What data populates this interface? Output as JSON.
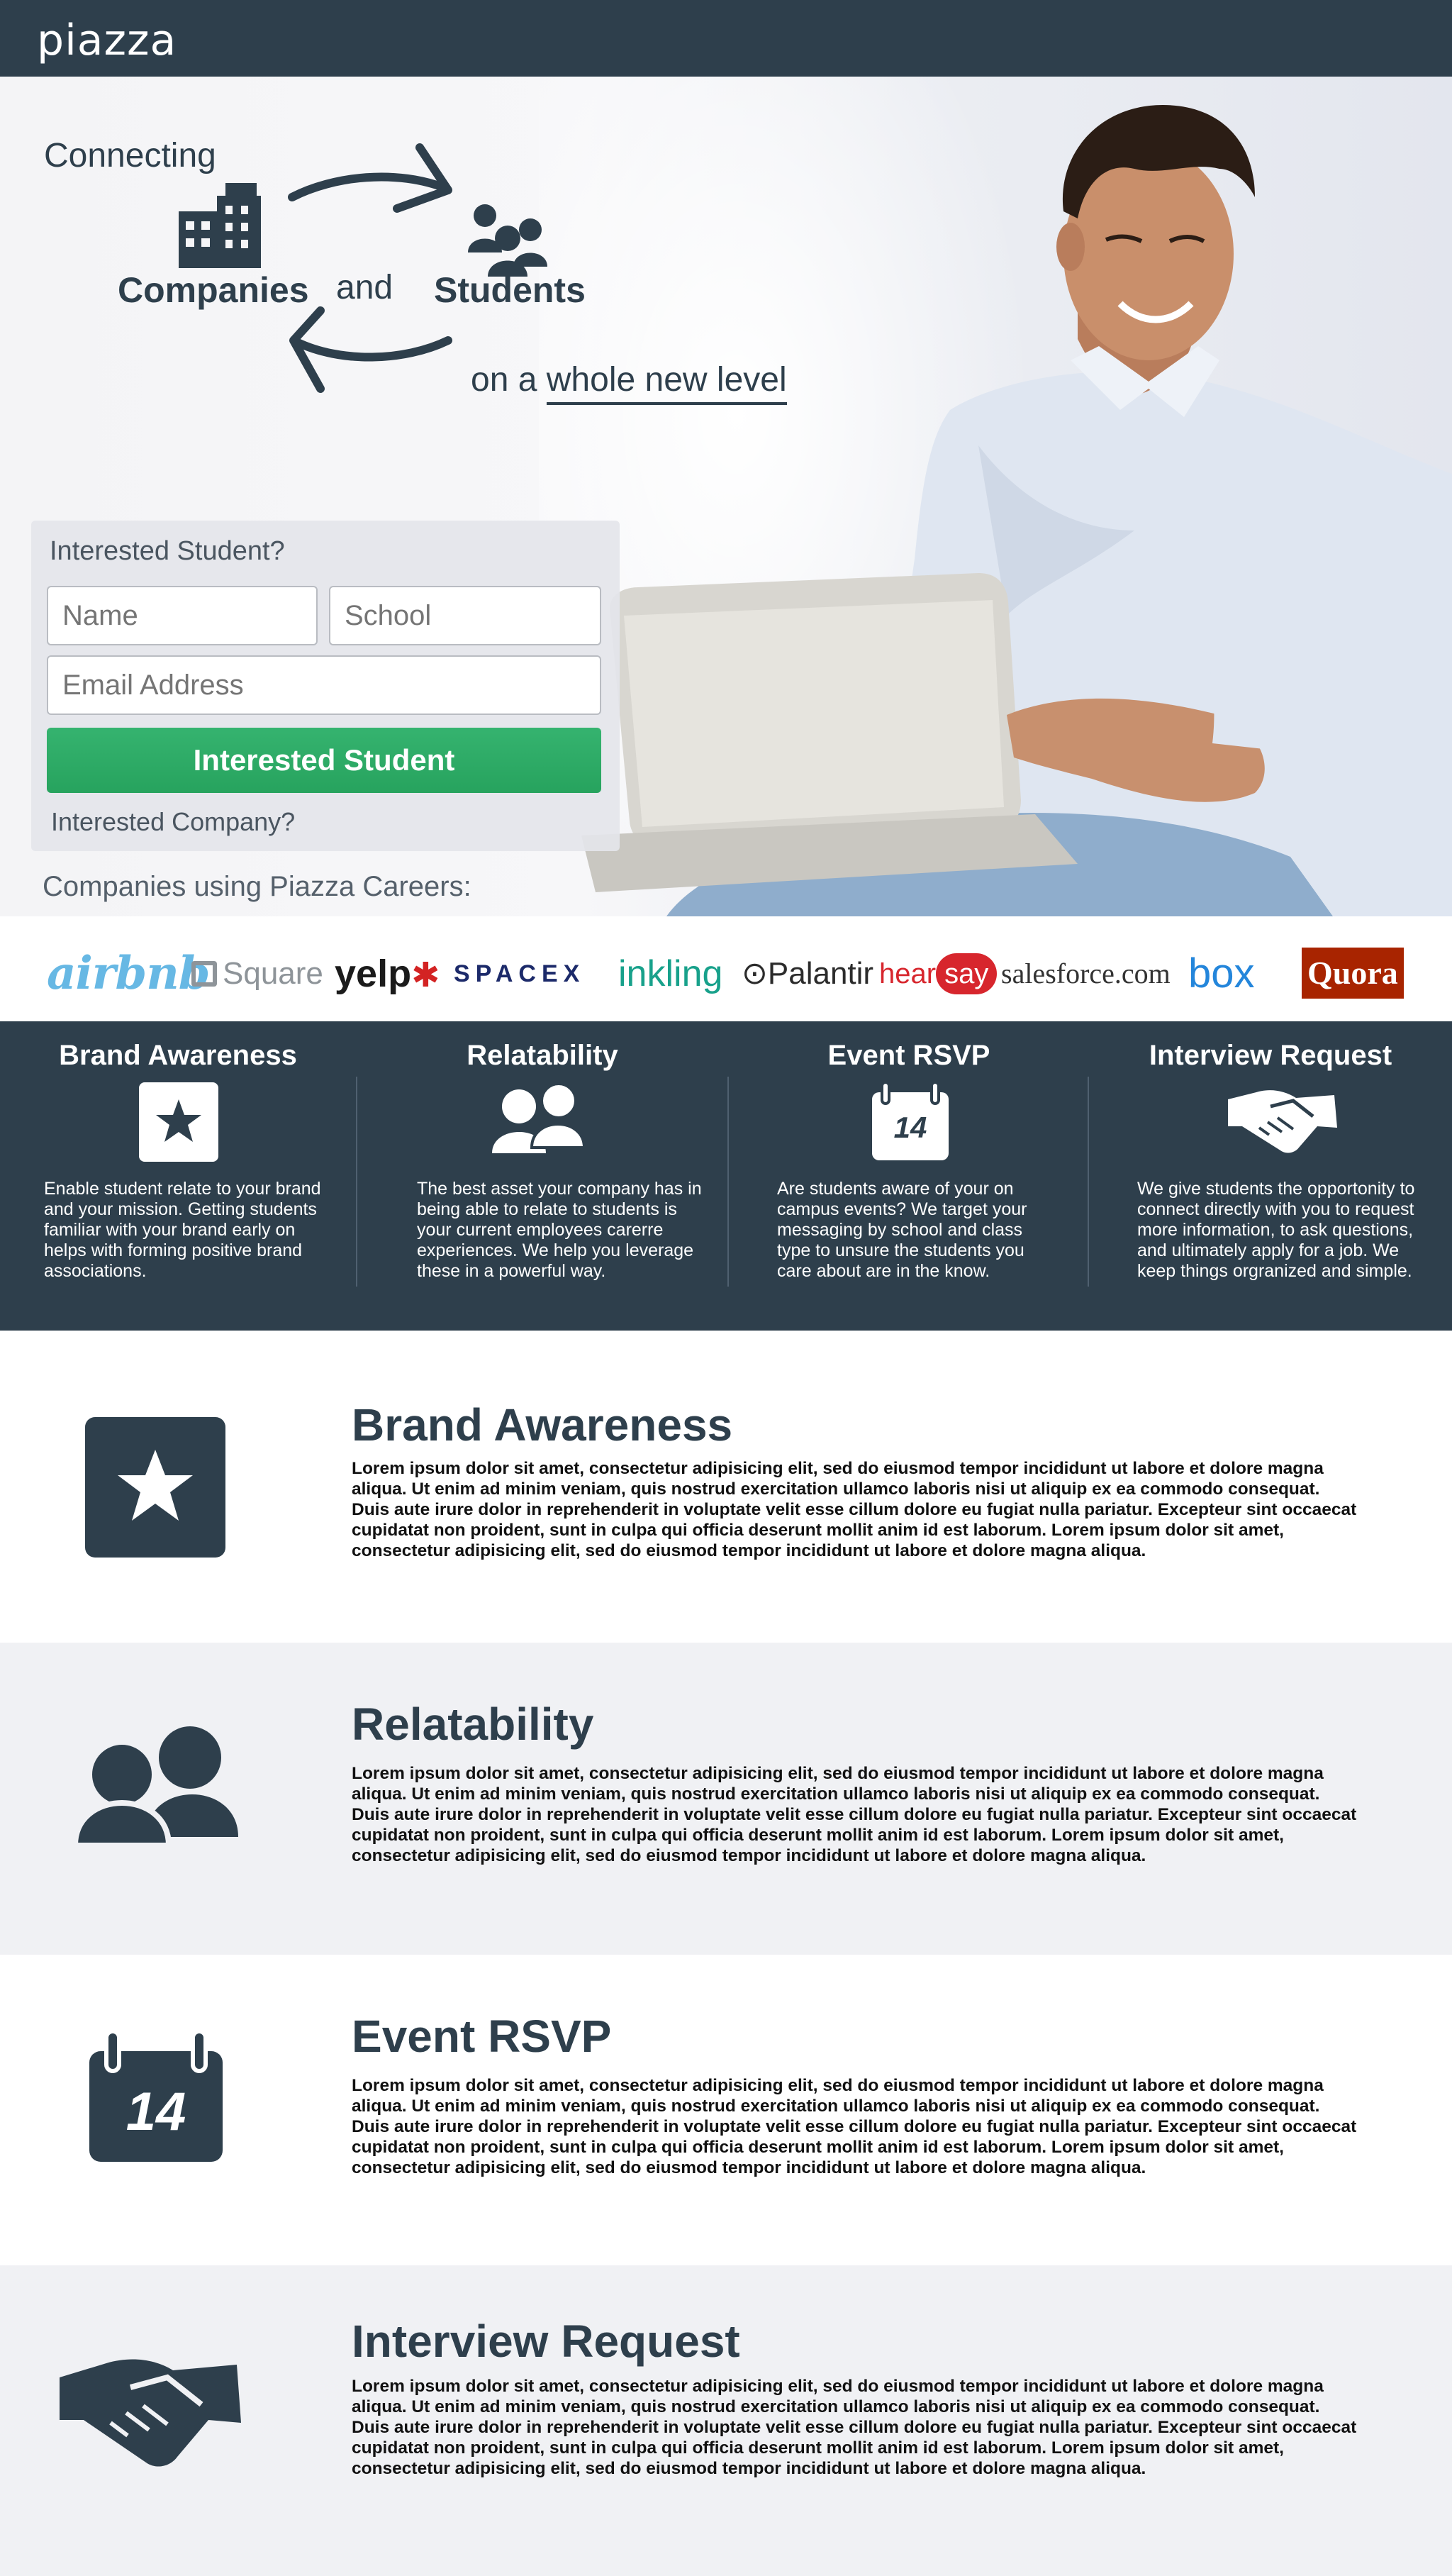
{
  "brand": {
    "logo": "piazza"
  },
  "hero": {
    "connecting": "Connecting",
    "companies": "Companies",
    "and": "and",
    "students": "Students",
    "on_a": "on a",
    "whole_new_level": "whole new level"
  },
  "form": {
    "title": "Interested Student?",
    "name_placeholder": "Name",
    "school_placeholder": "School",
    "email_placeholder": "Email Address",
    "submit_label": "Interested Student",
    "company_link": "Interested Company?"
  },
  "companies_label": "Companies using Piazza Careers:",
  "company_logos": {
    "airbnb": "airbnb",
    "square": "Square",
    "yelp": "yelp",
    "spacex": "SPACEX",
    "inkling": "inkling",
    "palantir": "Palantir",
    "hearsay_1": "hear",
    "hearsay_2": "say",
    "salesforce": "salesforce.com",
    "box": "box",
    "quora": "Quora"
  },
  "features": [
    {
      "title": "Brand Awareness",
      "icon": "star-icon",
      "text": "Enable student relate to your brand and your mission. Getting students familiar with your brand early on helps with forming positive brand associations."
    },
    {
      "title": "Relatability",
      "icon": "people-icon",
      "text": "The best asset your company has in being able to relate to students is your current employees carerre experiences. We help you leverage these in a powerful way."
    },
    {
      "title": "Event RSVP",
      "icon": "calendar-icon",
      "calendar_day": "14",
      "text": "Are students aware of your on campus events? We target your messaging by school and class type to unsure the students you care about are in the know."
    },
    {
      "title": "Interview Request",
      "icon": "handshake-icon",
      "text": "We give students the opportonity to connect directly with you to request more information, to ask questions, and ultimately apply for a job. We keep things orgranized and simple."
    }
  ],
  "sections": [
    {
      "title": "Brand Awareness",
      "body": "Lorem ipsum dolor sit amet, consectetur adipisicing elit, sed do eiusmod tempor incididunt ut labore et dolore magna aliqua. Ut enim ad minim veniam, quis nostrud exercitation ullamco laboris nisi ut aliquip ex ea commodo consequat. Duis aute irure dolor in reprehenderit in voluptate velit esse cillum dolore eu fugiat nulla pariatur. Excepteur sint occaecat cupidatat non proident, sunt in culpa qui officia deserunt mollit anim id est laborum. Lorem ipsum dolor sit amet, consectetur adipisicing elit, sed do eiusmod tempor incididunt ut labore et dolore magna aliqua."
    },
    {
      "title": "Relatability",
      "body": "Lorem ipsum dolor sit amet, consectetur adipisicing elit, sed do eiusmod tempor incididunt ut labore et dolore magna aliqua. Ut enim ad minim veniam, quis nostrud exercitation ullamco laboris nisi ut aliquip ex ea commodo consequat. Duis aute irure dolor in reprehenderit in voluptate velit esse cillum dolore eu fugiat nulla pariatur. Excepteur sint occaecat cupidatat non proident, sunt in culpa qui officia deserunt mollit anim id est laborum. Lorem ipsum dolor sit amet, consectetur adipisicing elit, sed do eiusmod tempor incididunt ut labore et dolore magna aliqua."
    },
    {
      "title": "Event RSVP",
      "calendar_day": "14",
      "body": "Lorem ipsum dolor sit amet, consectetur adipisicing elit, sed do eiusmod tempor incididunt ut labore et dolore magna aliqua. Ut enim ad minim veniam, quis nostrud exercitation ullamco laboris nisi ut aliquip ex ea commodo consequat. Duis aute irure dolor in reprehenderit in voluptate velit esse cillum dolore eu fugiat nulla pariatur. Excepteur sint occaecat cupidatat non proident, sunt in culpa qui officia deserunt mollit anim id est laborum. Lorem ipsum dolor sit amet, consectetur adipisicing elit, sed do eiusmod tempor incididunt ut labore et dolore magna aliqua."
    },
    {
      "title": "Interview Request",
      "body": "Lorem ipsum dolor sit amet, consectetur adipisicing elit, sed do eiusmod tempor incididunt ut labore et dolore magna aliqua. Ut enim ad minim veniam, quis nostrud exercitation ullamco laboris nisi ut aliquip ex ea commodo consequat. Duis aute irure dolor in reprehenderit in voluptate velit esse cillum dolore eu fugiat nulla pariatur. Excepteur sint occaecat cupidatat non proident, sunt in culpa qui officia deserunt mollit anim id est laborum. Lorem ipsum dolor sit amet, consectetur adipisicing elit, sed do eiusmod tempor incididunt ut labore et dolore magna aliqua."
    }
  ],
  "colors": {
    "navy": "#2e3f4c",
    "green": "#2aa862",
    "section_alt_bg": "#f0f1f4"
  }
}
